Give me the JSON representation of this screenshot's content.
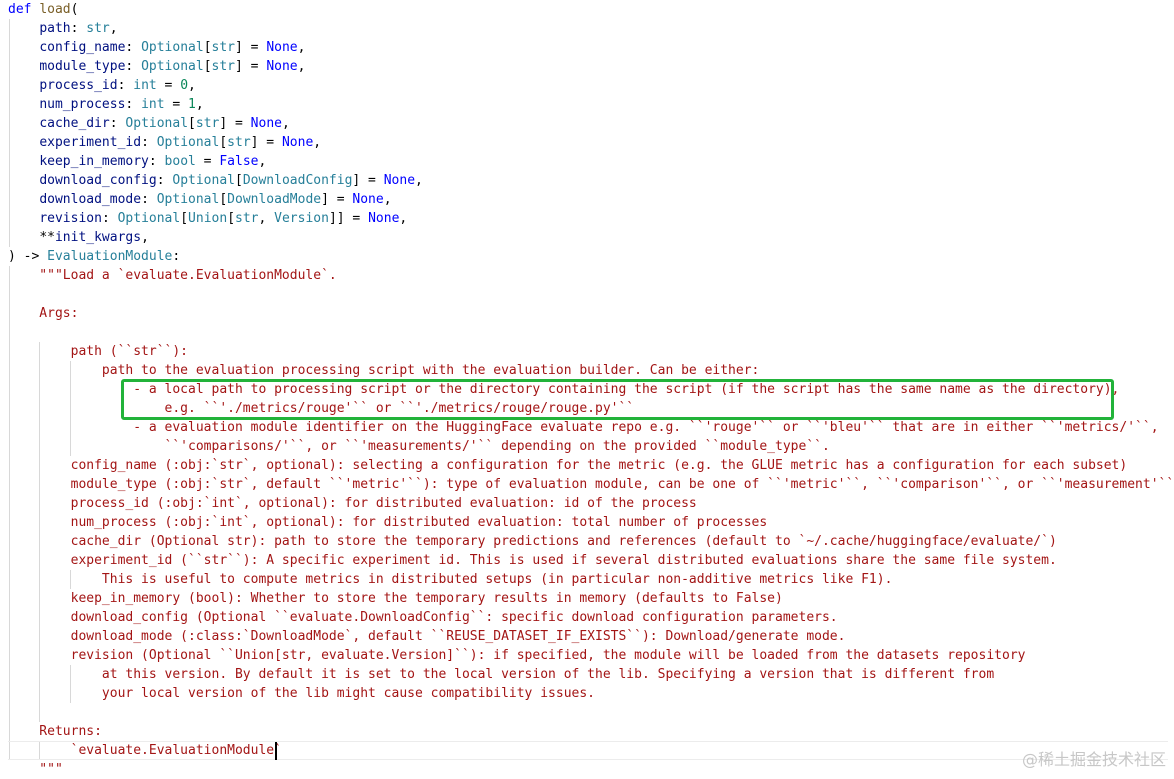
{
  "signature": {
    "def_kw": "def",
    "func_name": "load",
    "open_paren": "(",
    "params": [
      {
        "name": "path",
        "type": "str",
        "default": ""
      },
      {
        "name": "config_name",
        "type": "Optional[str]",
        "default": "None"
      },
      {
        "name": "module_type",
        "type": "Optional[str]",
        "default": "None"
      },
      {
        "name": "process_id",
        "type": "int",
        "default": "0"
      },
      {
        "name": "num_process",
        "type": "int",
        "default": "1"
      },
      {
        "name": "cache_dir",
        "type": "Optional[str]",
        "default": "None"
      },
      {
        "name": "experiment_id",
        "type": "Optional[str]",
        "default": "None"
      },
      {
        "name": "keep_in_memory",
        "type": "bool",
        "default": "False"
      },
      {
        "name": "download_config",
        "type": "Optional[DownloadConfig]",
        "default": "None"
      },
      {
        "name": "download_mode",
        "type": "Optional[DownloadMode]",
        "default": "None"
      },
      {
        "name": "revision",
        "type": "Optional[Union[str, Version]]",
        "default": "None"
      }
    ],
    "kwargs": "**init_kwargs",
    "close": ") ->",
    "return_type": "EvaluationModule",
    "colon": ":"
  },
  "docstring": [
    "\"\"\"Load a `evaluate.EvaluationModule`.",
    "",
    "Args:",
    "",
    "    path (``str``):",
    "        path to the evaluation processing script with the evaluation builder. Can be either:",
    "            - a local path to processing script or the directory containing the script (if the script has the same name as the directory),",
    "                e.g. ``'./metrics/rouge'`` or ``'./metrics/rouge/rouge.py'``",
    "            - a evaluation module identifier on the HuggingFace evaluate repo e.g. ``'rouge'`` or ``'bleu'`` that are in either ``'metrics/'``,",
    "                ``'comparisons/'``, or ``'measurements/'`` depending on the provided ``module_type``.",
    "    config_name (:obj:`str`, optional): selecting a configuration for the metric (e.g. the GLUE metric has a configuration for each subset)",
    "    module_type (:obj:`str`, default ``'metric'``): type of evaluation module, can be one of ``'metric'``, ``'comparison'``, or ``'measurement'``.",
    "    process_id (:obj:`int`, optional): for distributed evaluation: id of the process",
    "    num_process (:obj:`int`, optional): for distributed evaluation: total number of processes",
    "    cache_dir (Optional str): path to store the temporary predictions and references (default to `~/.cache/huggingface/evaluate/`)",
    "    experiment_id (``str``): A specific experiment id. This is used if several distributed evaluations share the same file system.",
    "        This is useful to compute metrics in distributed setups (in particular non-additive metrics like F1).",
    "    keep_in_memory (bool): Whether to store the temporary results in memory (defaults to False)",
    "    download_config (Optional ``evaluate.DownloadConfig``: specific download configuration parameters.",
    "    download_mode (:class:`DownloadMode`, default ``REUSE_DATASET_IF_EXISTS``): Download/generate mode.",
    "    revision (Optional ``Union[str, evaluate.Version]``): if specified, the module will be loaded from the datasets repository",
    "        at this version. By default it is set to the local version of the lib. Specifying a version that is different from",
    "        your local version of the lib might cause compatibility issues.",
    "",
    "Returns:",
    "    `evaluate.EvaluationModule`",
    "\"\"\""
  ],
  "watermark": "@稀土掘金技术社区",
  "colors": {
    "keyword": "#0000ff",
    "function": "#795e26",
    "parameter": "#001080",
    "type": "#267f99",
    "number": "#098658",
    "docstring": "#a31515",
    "highlight_box": "#22b33a"
  }
}
